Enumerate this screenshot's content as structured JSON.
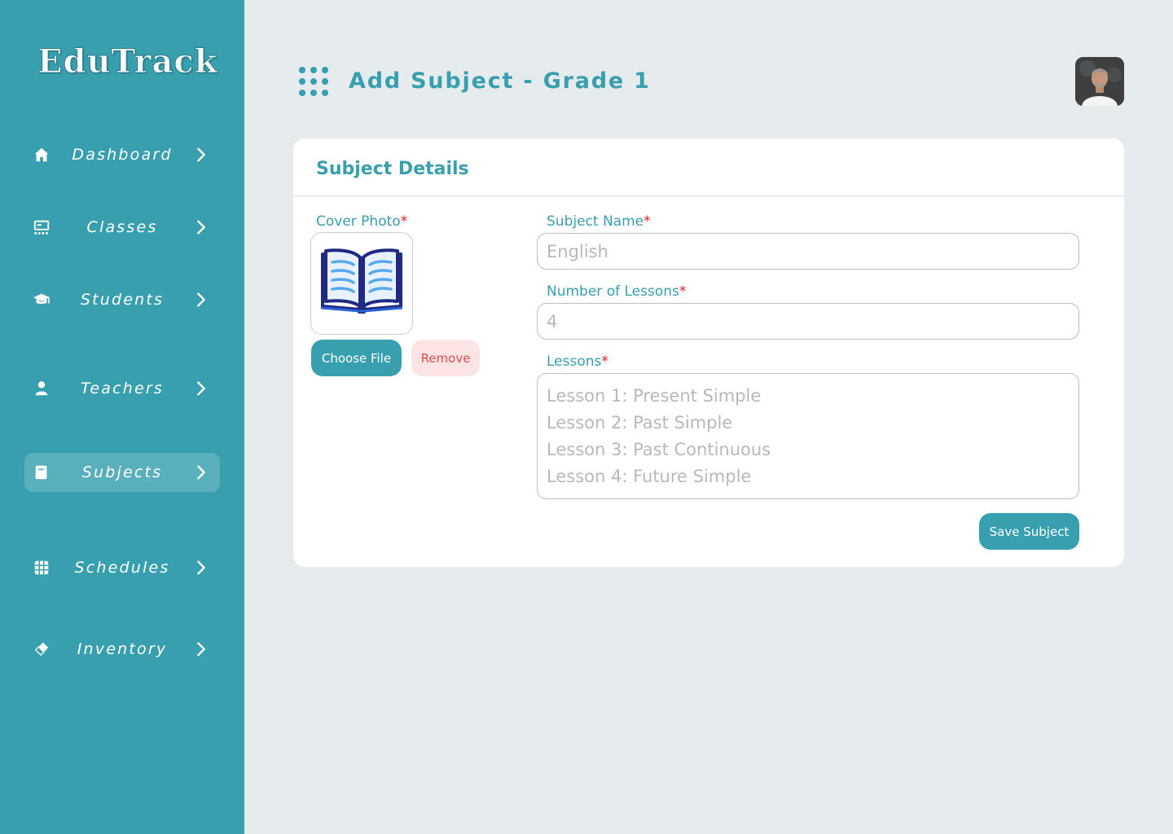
{
  "app": {
    "logo": "EduTrack"
  },
  "sidebar": {
    "items": [
      {
        "label": "Dashboard",
        "icon": "home-icon",
        "active": false
      },
      {
        "label": "Classes",
        "icon": "classroom-board-icon",
        "active": false
      },
      {
        "label": "Students",
        "icon": "graduation-cap-icon",
        "active": false
      },
      {
        "label": "Teachers",
        "icon": "person-icon",
        "active": false
      },
      {
        "label": "Subjects",
        "icon": "book-icon",
        "active": true
      },
      {
        "label": "Schedules",
        "icon": "calendar-grid-icon",
        "active": false
      },
      {
        "label": "Inventory",
        "icon": "eraser-icon",
        "active": false
      }
    ]
  },
  "header": {
    "title": "Add Subject - Grade 1",
    "menu_icon": "dots-grid-icon",
    "avatar": "user-avatar"
  },
  "form": {
    "section_title": "Subject Details",
    "cover_photo": {
      "label": "Cover Photo",
      "required_mark": "*",
      "choose_label": "Choose File",
      "remove_label": "Remove",
      "image": "open-book-icon"
    },
    "subject_name": {
      "label": "Subject Name",
      "required_mark": "*",
      "placeholder": "English"
    },
    "num_lessons": {
      "label": "Number of Lessons",
      "required_mark": "*",
      "placeholder": "4"
    },
    "lessons": {
      "label": "Lessons",
      "required_mark": "*",
      "lines": [
        "Lesson 1: Present Simple",
        "Lesson 2: Past Simple",
        "Lesson 3: Past Continuous",
        "Lesson 4: Future Simple"
      ]
    },
    "save_label": "Save Subject"
  },
  "colors": {
    "primary": "#389fae",
    "background": "#e6ebee",
    "danger": "#e04b4b",
    "danger_bg": "#fde4e4",
    "required": "#e02020"
  }
}
